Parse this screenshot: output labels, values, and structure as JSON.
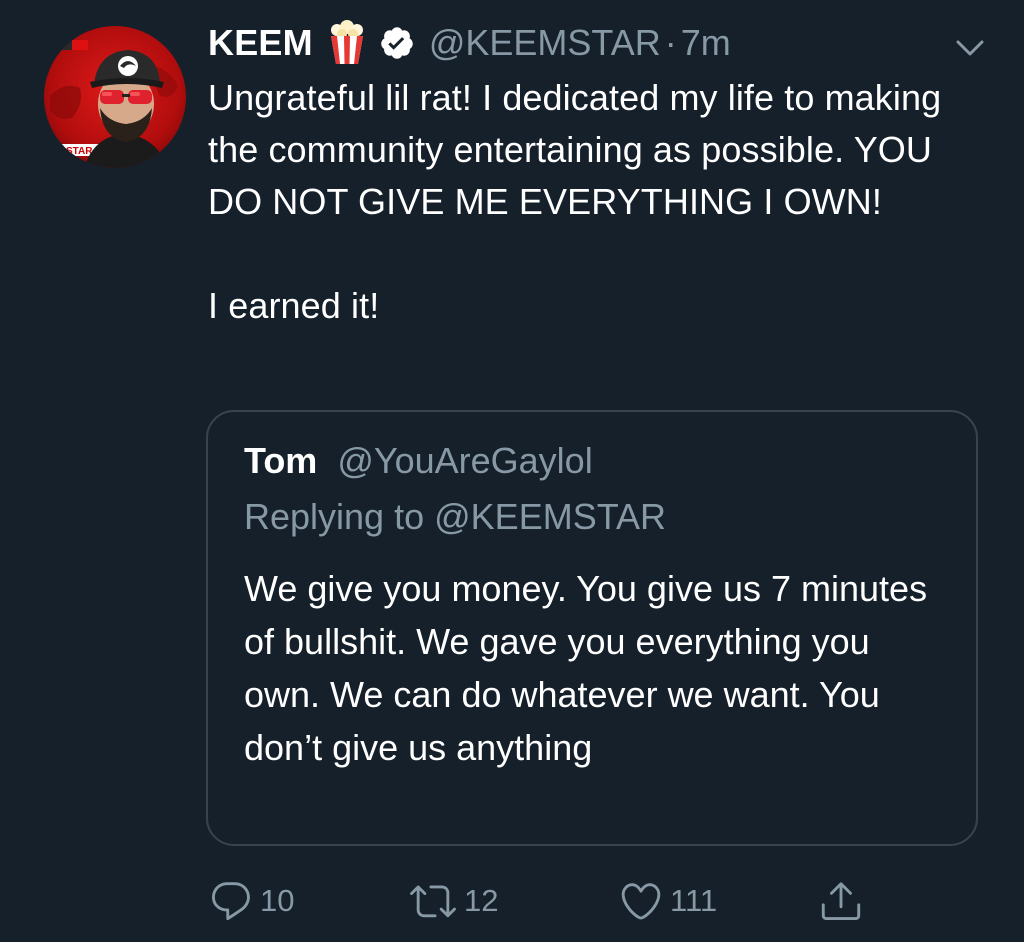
{
  "tweet": {
    "author": {
      "display_name": "KEEM",
      "handle": "@KEEMSTAR",
      "emoji": "popcorn-icon",
      "verified": true
    },
    "separator": "·",
    "time": "7m",
    "text_paragraphs": [
      "Ungrateful lil rat! I dedicated my life to making the community entertaining as possible. YOU DO NOT GIVE ME EVERYTHING I OWN!",
      "I earned it!"
    ],
    "avatar_badge_text": "STAR"
  },
  "quoted_tweet": {
    "display_name": "Tom",
    "handle": "@YouAreGaylol",
    "replying_prefix": "Replying to",
    "replying_to": "@KEEMSTAR",
    "text": "We give you money. You give us 7 minutes of bullshit. We gave you everything you own. We can do whatever we want. You don’t give us anything"
  },
  "actions": {
    "reply_count": "10",
    "retweet_count": "12",
    "like_count": "111"
  },
  "colors": {
    "background": "#15202b",
    "text_primary": "#ffffff",
    "text_secondary": "#8899a6",
    "border": "#38444d"
  }
}
